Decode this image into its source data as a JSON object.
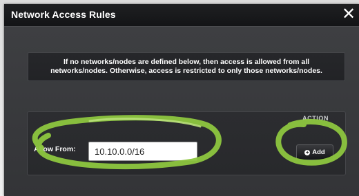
{
  "dialog": {
    "title": "Network Access Rules",
    "close_symbol": "✕"
  },
  "notice": {
    "text": "If no networks/nodes are defined below, then access is allowed from all networks/nodes. Otherwise, access is restricted to only those networks/nodes."
  },
  "rules": {
    "action_header": "ACTION",
    "allow_from_label": "Allow From:",
    "network_value": "10.10.0.0/16",
    "add_button_label": "Add",
    "add_icon": "plus-circle-icon"
  },
  "annotation": {
    "highlight_color": "#8dc63f"
  }
}
